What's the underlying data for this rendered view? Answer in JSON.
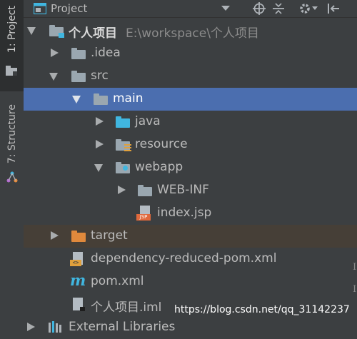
{
  "header": {
    "title": "Project"
  },
  "sidebar": {
    "project_tab": "1: Project",
    "structure_tab": "7: Structure"
  },
  "tree": {
    "root": {
      "name": "个人项目",
      "path": "E:\\workspace\\个人项目"
    },
    "idea": ".idea",
    "src": "src",
    "main": "main",
    "java": "java",
    "resource": "resource",
    "webapp": "webapp",
    "webinf": "WEB-INF",
    "index_jsp": "index.jsp",
    "target": "target",
    "dep_pom": "dependency-reduced-pom.xml",
    "pom": "pom.xml",
    "iml": "个人项目.iml",
    "ext_libs": "External Libraries"
  },
  "watermark": "https://blog.csdn.net/qq_31142237",
  "colors": {
    "selected": "#4b6eaf",
    "excluded": "#463f37",
    "folder_source": "#40b6e0",
    "folder_excluded": "#e0893c"
  }
}
